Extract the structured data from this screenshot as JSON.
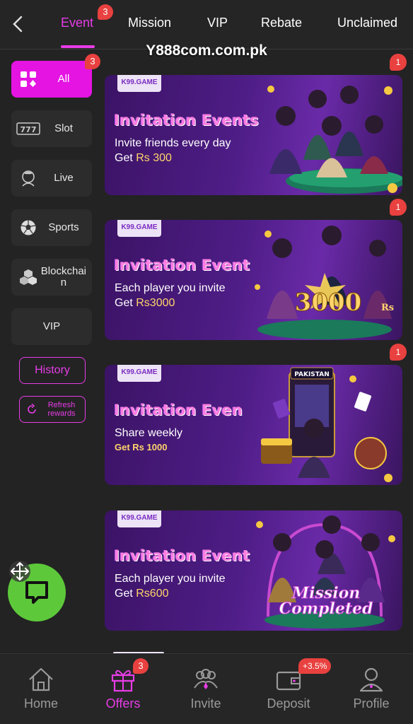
{
  "header": {
    "tabs": [
      {
        "label": "Event",
        "badge": "3"
      },
      {
        "label": "Mission"
      },
      {
        "label": "VIP"
      },
      {
        "label": "Rebate"
      },
      {
        "label": "Unclaimed"
      }
    ],
    "active_tab": "Event",
    "accent": "#e73ce6"
  },
  "watermark": "Y888com.com.pk",
  "sidebar": {
    "items": [
      {
        "label": "All",
        "badge": "3",
        "icon": "grid-icon",
        "active": true
      },
      {
        "label": "Slot",
        "icon": "slot-777-icon"
      },
      {
        "label": "Live",
        "icon": "live-dealer-icon"
      },
      {
        "label": "Sports",
        "icon": "soccer-ball-icon"
      },
      {
        "label": "Blockchai\nn",
        "icon": "blockchain-cubes-icon"
      },
      {
        "label": "VIP"
      }
    ],
    "history_label": "History",
    "refresh_label_1": "Refresh",
    "refresh_label_2": "rewards"
  },
  "banners": [
    {
      "tag": "K99.GAME",
      "title": "Invitation Events",
      "line1": "Invite friends every day",
      "line2_prefix": "Get ",
      "amount": "Rs 300",
      "badge": "1",
      "art_text": ""
    },
    {
      "tag": "K99.GAME",
      "title": "Invitation Event",
      "line1": "Each player you invite",
      "line2_prefix": "Get ",
      "amount": "Rs3000",
      "badge": "1",
      "art_text": "3000",
      "art_sub": "Rs"
    },
    {
      "tag": "K99.GAME",
      "title": "Invitation Even",
      "line1": "Share weekly",
      "line2_prefix": "",
      "amount": "Get Rs 1000",
      "badge": "1",
      "art_text": "PAKISTAN"
    },
    {
      "tag": "K99.GAME",
      "title": "Invitation Event",
      "line1": "Each player you invite",
      "line2_prefix": "Get ",
      "amount": "Rs600",
      "art_text": "Mission",
      "art_text2": "Completed"
    }
  ],
  "bottom_nav": {
    "items": [
      {
        "label": "Home",
        "icon": "home-icon"
      },
      {
        "label": "Offers",
        "icon": "gift-icon",
        "badge": "3",
        "active": true
      },
      {
        "label": "Invite",
        "icon": "invite-people-icon"
      },
      {
        "label": "Deposit",
        "icon": "wallet-icon",
        "badge": "+3.5%"
      },
      {
        "label": "Profile",
        "icon": "profile-icon"
      }
    ]
  },
  "colors": {
    "badge": "#e8413f",
    "chat_fab": "#5dc93a",
    "active_side": "#e514e2"
  }
}
